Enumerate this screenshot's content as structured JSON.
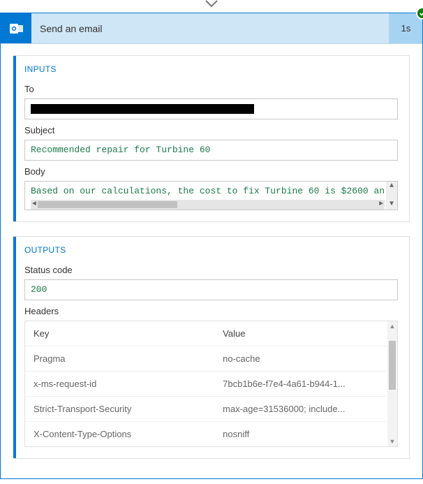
{
  "header": {
    "title": "Send an email",
    "duration": "1s"
  },
  "inputs": {
    "section_title": "INPUTS",
    "to_label": "To",
    "to_value": "",
    "subject_label": "Subject",
    "subject_value": "Recommended repair for Turbine 60",
    "body_label": "Body",
    "body_value": "Based on our calculations, the cost to fix Turbine 60 is $2600 an"
  },
  "outputs": {
    "section_title": "OUTPUTS",
    "status_label": "Status code",
    "status_value": "200",
    "headers_label": "Headers",
    "headers_key_col": "Key",
    "headers_value_col": "Value",
    "headers": [
      {
        "key": "Pragma",
        "value": "no-cache"
      },
      {
        "key": "x-ms-request-id",
        "value": "7bcb1b6e-f7e4-4a61-b944-1..."
      },
      {
        "key": "Strict-Transport-Security",
        "value": "max-age=31536000; include..."
      },
      {
        "key": "X-Content-Type-Options",
        "value": "nosniff"
      }
    ]
  }
}
